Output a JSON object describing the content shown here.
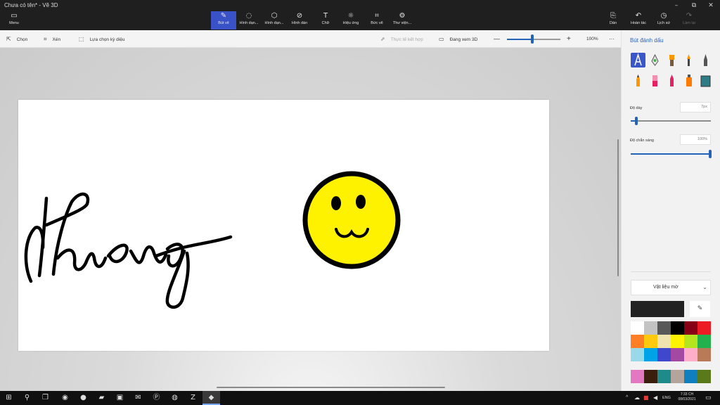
{
  "window": {
    "title": "Chưa có tên* - Vẽ 3D",
    "controls": {
      "minimize": "–",
      "restore": "⧉",
      "close": "✕"
    }
  },
  "ribbon": {
    "menu": {
      "label": "Menu",
      "icon": "folder-icon"
    },
    "tools": [
      {
        "label": "Bút vẽ",
        "icon": "brush-icon",
        "active": true
      },
      {
        "label": "Hình dạn...",
        "icon": "2d-shapes-icon"
      },
      {
        "label": "Hình dạn...",
        "icon": "3d-shapes-icon"
      },
      {
        "label": "Hình dán",
        "icon": "sticker-icon"
      },
      {
        "label": "Chữ",
        "icon": "text-icon"
      },
      {
        "label": "Hiệu ứng",
        "icon": "effects-icon"
      },
      {
        "label": "Bức vẽ",
        "icon": "canvas-icon"
      },
      {
        "label": "Thư viện...",
        "icon": "3d-library-icon"
      }
    ],
    "right_actions": [
      {
        "label": "Dán",
        "icon": "paste-icon"
      },
      {
        "label": "Hoàn tác",
        "icon": "undo-icon"
      },
      {
        "label": "Lịch sử",
        "icon": "history-icon"
      },
      {
        "label": "Làm lại",
        "icon": "redo-icon",
        "disabled": true
      }
    ]
  },
  "subtoolbar": {
    "select": "Chọn",
    "crop": "Xén",
    "magic_select": "Lựa chọn kỳ diệu",
    "mixed_reality": "Thực tế kết hợp",
    "view_3d": "Đang xem 3D",
    "zoom_out": "—",
    "zoom_in": "+",
    "zoom_level": "100%",
    "more": "···"
  },
  "panel": {
    "title": "Bút đánh dấu",
    "brushes": [
      {
        "name": "marker",
        "color": "#ffffff",
        "selected": true
      },
      {
        "name": "calligraphy-pen",
        "color": "#4caf50"
      },
      {
        "name": "oil-brush",
        "color": "#ff9800"
      },
      {
        "name": "watercolor",
        "color": "#ff9800"
      },
      {
        "name": "pixel-pen",
        "color": "#555555"
      },
      {
        "name": "pencil",
        "color": "#ff9800"
      },
      {
        "name": "eraser",
        "color": "#e91e63"
      },
      {
        "name": "crayon",
        "color": "#e91e63"
      },
      {
        "name": "spray-can",
        "color": "#ff7a00"
      },
      {
        "name": "fill",
        "color": "#2e7d86"
      }
    ],
    "thickness_label": "Độ dày",
    "thickness_value": "7px",
    "thickness_fraction": 0.07,
    "opacity_label": "Độ chắn sáng",
    "opacity_value": "100%",
    "opacity_fraction": 1.0,
    "material_label": "Vật liệu mờ",
    "current_color": "#222222",
    "palette": [
      "#ffffff",
      "#c3c3c3",
      "#585858",
      "#000000",
      "#880015",
      "#ed1c24",
      "#ff7f27",
      "#ffc90e",
      "#efe4b0",
      "#fff200",
      "#b5e61d",
      "#22b14c",
      "#99d9ea",
      "#00a2e8",
      "#3f48cc",
      "#a349a4",
      "#ffaec9",
      "#b97a57",
      "#e377c2",
      "#3b1f0e",
      "#1f8a8a",
      "#b3a49c",
      "#0f7fc0",
      "#5a7a1a"
    ]
  },
  "canvas": {
    "background": "#ffffff",
    "drawing": {
      "ink": "#000000",
      "smiley_fill": "#fff200"
    }
  },
  "taskbar": {
    "apps": [
      {
        "name": "windows-start-icon",
        "glyph": "⊞"
      },
      {
        "name": "search-icon",
        "glyph": "⚲"
      },
      {
        "name": "task-view-icon",
        "glyph": "❐"
      },
      {
        "name": "edge-icon",
        "glyph": "◉"
      },
      {
        "name": "chrome-icon",
        "glyph": "●"
      },
      {
        "name": "file-explorer-icon",
        "glyph": "▰"
      },
      {
        "name": "store-icon",
        "glyph": "▣"
      },
      {
        "name": "mail-icon",
        "glyph": "✉"
      },
      {
        "name": "pinterest-icon",
        "glyph": "Ⓟ"
      },
      {
        "name": "spotify-icon",
        "glyph": "◍"
      },
      {
        "name": "zalo-icon",
        "glyph": "Z"
      },
      {
        "name": "paint-3d-icon",
        "glyph": "◆",
        "active": true
      }
    ],
    "tray": {
      "chevron": "^",
      "language": "ENG",
      "time": "7:33 CH",
      "date": "08/03/2021",
      "notifications": "▭"
    }
  }
}
